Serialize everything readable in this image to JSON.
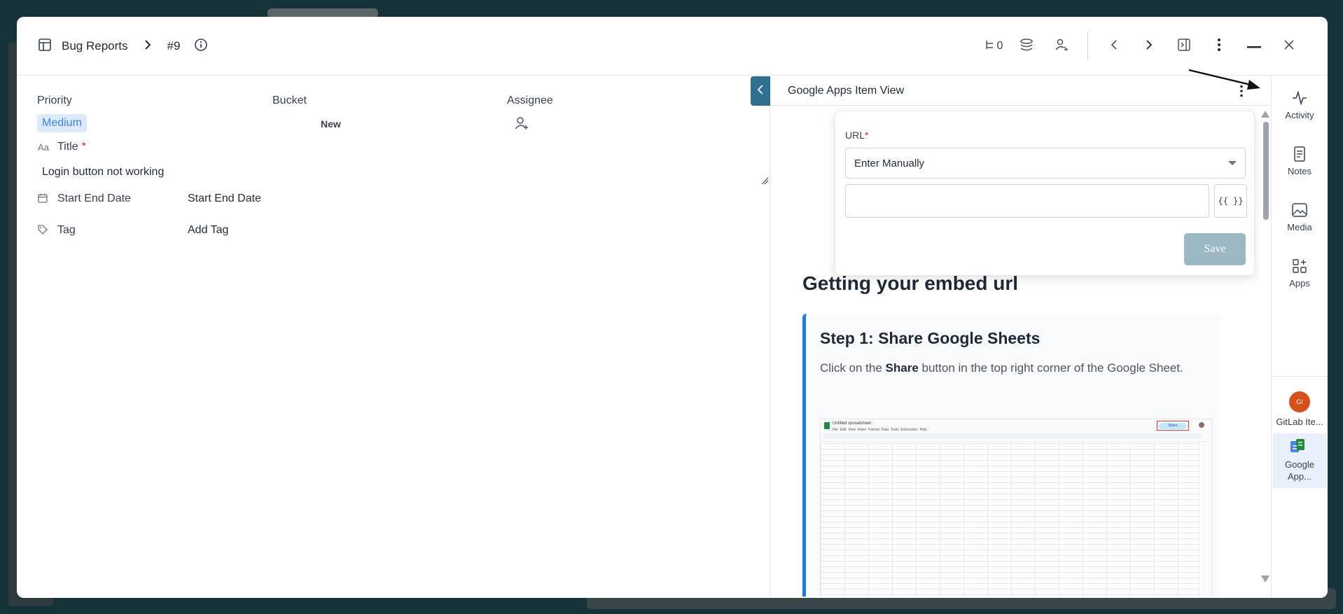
{
  "header": {
    "board_name": "Bug Reports",
    "item_id": "#9",
    "subitems_count": "0"
  },
  "fields": {
    "priority_label": "Priority",
    "priority_value": "Medium",
    "bucket_label": "Bucket",
    "bucket_value": "New",
    "assignee_label": "Assignee",
    "title_label": "Title",
    "title_required": "*",
    "title_value": "Login button not working",
    "start_end_label": "Start End Date",
    "start_end_value": "Start End Date",
    "tag_label": "Tag",
    "tag_value": "Add Tag"
  },
  "panel": {
    "title": "Google Apps Item View",
    "url_label": "URL",
    "url_required": "*",
    "source_select": "Enter Manually",
    "url_input_value": "",
    "variables_button": "{{ }}",
    "save_button": "Save",
    "doc_heading": "Getting your embed url",
    "step_title": "Step 1: Share Google Sheets",
    "step_text_pre": "Click on the ",
    "step_text_bold": "Share",
    "step_text_post": " button in the top right corner of the Google Sheet.",
    "sheet_title": "Untitled spreadsheet",
    "sheet_menu": "File  Edit  View  Insert  Format  Data  Tools  Extensions  Help",
    "sheet_share": "Share"
  },
  "rail": {
    "activity": "Activity",
    "notes": "Notes",
    "media": "Media",
    "apps": "Apps",
    "gitlab_avatar": "GI",
    "gitlab_label": "GitLab Ite...",
    "google_label": "Google App..."
  },
  "colors": {
    "accent": "#2f6f8f",
    "badge_bg": "#dbeafe",
    "badge_fg": "#3b82f6",
    "save_disabled": "#9db8c5",
    "step_border": "#1d7af0",
    "gitlab_avatar": "#d94f1b"
  }
}
